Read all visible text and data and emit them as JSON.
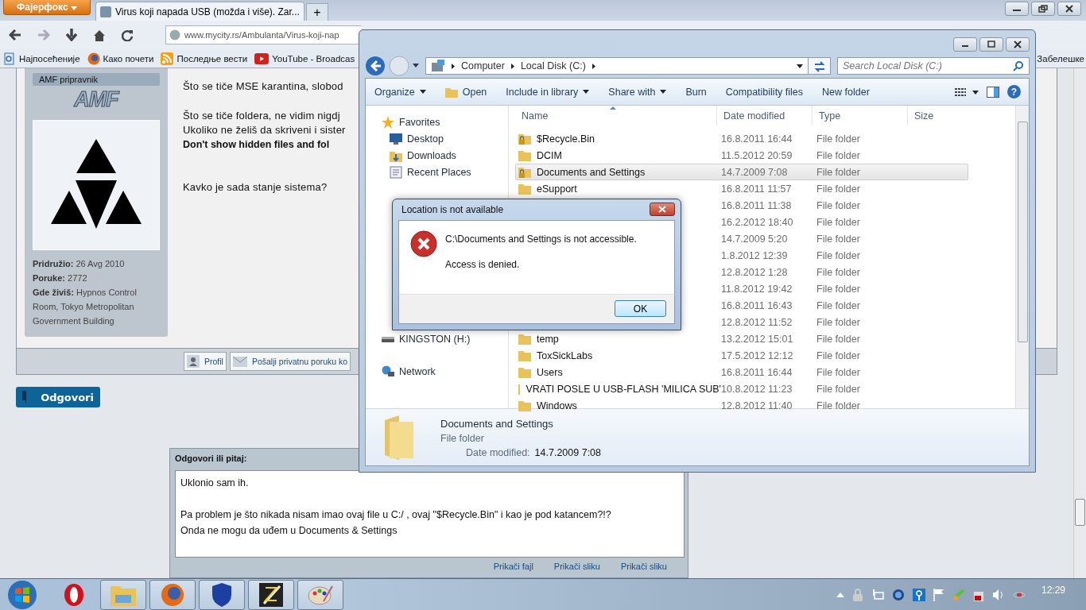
{
  "browser": {
    "menu_button": "Фајерфокс",
    "tabs": [
      {
        "title": "Virus koji napada USB (možda i više). Zar...",
        "selected": true
      }
    ],
    "new_tab": "+",
    "url": "www.mycity.rs/Ambulanta/Virus-koji-nap",
    "bookmarks": [
      {
        "label": "Најпосећеније",
        "kind": "page"
      },
      {
        "label": "Како почети",
        "kind": "firefox"
      },
      {
        "label": "Последње вести",
        "kind": "rss"
      },
      {
        "label": "YouTube - Broadcas",
        "kind": "youtube"
      }
    ],
    "bookmarks_right": "Забелешке"
  },
  "post": {
    "user": {
      "rank": "AMF pripravnik",
      "logo": "AMF",
      "details": [
        "**Pridružio:** 26 Avg 2010",
        "**Poruke:** 2772",
        "**Gde živiš:** Hypnos Control Room, Tokyo Metropolitan Government Building"
      ]
    },
    "paragraphs": [
      [
        {
          "text": "Što se tiče MSE karantina, slobod",
          "bold": false
        }
      ],
      [
        {
          "text": "Što se tiče foldera, ne vidim nigdj",
          "bold": false
        },
        {
          "text": "Ukoliko ne želiš da skriveni i sister",
          "bold": false
        },
        {
          "text": "Don't show hidden files and fol",
          "bold": true
        }
      ],
      [
        {
          "text": "Kavko je sada stanje sistema?",
          "bold": false
        }
      ]
    ],
    "footer_buttons": [
      {
        "label": "Profil",
        "kind": "profile"
      },
      {
        "label": "Pošalji privatnu poruku ko",
        "kind": "mail"
      }
    ]
  },
  "reply_button": "Odgovori",
  "reply": {
    "heading": "Odgovori ili pitaj:",
    "text": "Uklonio sam ih.\n\nPa problem je što nikada nisam imao ovaj file u C:/ , ovaj \"$Recycle.Bin\" i kao je pod katancem?!?\nOnda ne mogu da uđem u Documents & Settings",
    "attachments": [
      "Prikači fajl",
      "Prikači sliku",
      "Prikači sliku"
    ]
  },
  "explorer": {
    "breadcrumb": [
      "Computer",
      "Local Disk (C:)"
    ],
    "search": {
      "placeholder": "Search Local Disk (C:)"
    },
    "toolbar": [
      {
        "label": "Organize",
        "kind": "menu"
      },
      {
        "label": "Open",
        "kind": "open"
      },
      {
        "label": "Include in library",
        "kind": "menu"
      },
      {
        "label": "Share with",
        "kind": "menu"
      },
      {
        "label": "Burn",
        "kind": "plain"
      },
      {
        "label": "Compatibility files",
        "kind": "plain"
      },
      {
        "label": "New folder",
        "kind": "plain"
      }
    ],
    "nav": [
      {
        "label": "Favorites",
        "kind": "star",
        "children": [
          {
            "label": "Desktop",
            "kind": "desktop"
          },
          {
            "label": "Downloads",
            "kind": "downloads"
          },
          {
            "label": "Recent Places",
            "kind": "recent"
          }
        ]
      },
      {
        "label": "KINGSTON (H:)",
        "kind": "drive"
      },
      {
        "label": "Network",
        "kind": "network"
      }
    ],
    "help_button": "?",
    "columns": [
      {
        "label": "Name",
        "sorted": true
      },
      {
        "label": "Date modified",
        "sorted": false
      },
      {
        "label": "Type",
        "sorted": false
      },
      {
        "label": "Size",
        "sorted": false
      }
    ],
    "rows": [
      {
        "name": "$Recycle.Bin",
        "date": "16.8.2011 16:44",
        "type": "File folder",
        "locked": true,
        "selected": false
      },
      {
        "name": "DCIM",
        "date": "11.5.2012 20:59",
        "type": "File folder",
        "locked": false,
        "selected": false
      },
      {
        "name": "Documents and Settings",
        "date": "14.7.2009 7:08",
        "type": "File folder",
        "locked": true,
        "selected": true
      },
      {
        "name": "eSupport",
        "date": "16.8.2011 11:57",
        "type": "File folder",
        "locked": false,
        "selected": false
      },
      {
        "date": "16.8.2011 11:38",
        "type": "File folder",
        "selected": false
      },
      {
        "date": "16.2.2012 18:40",
        "type": "File folder",
        "selected": false
      },
      {
        "date": "14.7.2009 5:20",
        "type": "File folder",
        "selected": false
      },
      {
        "date": "1.8.2012 12:39",
        "type": "File folder",
        "selected": false
      },
      {
        "date": "12.8.2012 1:28",
        "type": "File folder",
        "selected": false
      },
      {
        "date": "11.8.2012 19:42",
        "type": "File folder",
        "selected": false
      },
      {
        "date": "16.8.2011 16:43",
        "type": "File folder",
        "selected": false
      },
      {
        "date": "12.8.2012 11:52",
        "type": "File folder",
        "selected": false
      },
      {
        "name": "temp",
        "date": "13.2.2012 15:01",
        "type": "File folder",
        "locked": false,
        "selected": false
      },
      {
        "name": "ToxSickLabs",
        "date": "17.5.2012 12:12",
        "type": "File folder",
        "locked": false,
        "selected": false
      },
      {
        "name": "Users",
        "date": "16.8.2011 16:44",
        "type": "File folder",
        "locked": false,
        "selected": false
      },
      {
        "name": "VRATI POSLE U USB-FLASH 'MILICA SUB'",
        "date": "10.8.2012 11:23",
        "type": "File folder",
        "locked": false,
        "selected": false
      },
      {
        "name": "Windows",
        "date": "12.8.2012 11:40",
        "type": "File folder",
        "locked": false,
        "selected": false
      }
    ],
    "details": {
      "name": "Documents and Settings",
      "type": "File folder",
      "date_label": "Date modified:",
      "date": "14.7.2009 7:08"
    }
  },
  "dialog": {
    "title": "Location is not available",
    "messages": [
      "C:\\Documents and Settings is not accessible.",
      "Access is denied."
    ],
    "button": "OK"
  },
  "taskbar": {
    "apps": [
      {
        "kind": "opera",
        "running": false
      },
      {
        "kind": "folder",
        "running": true
      },
      {
        "kind": "firefox",
        "running": true
      },
      {
        "kind": "shield",
        "running": true
      },
      {
        "kind": "sword",
        "running": true
      },
      {
        "kind": "palette",
        "running": true
      }
    ],
    "clock": "12:29"
  }
}
